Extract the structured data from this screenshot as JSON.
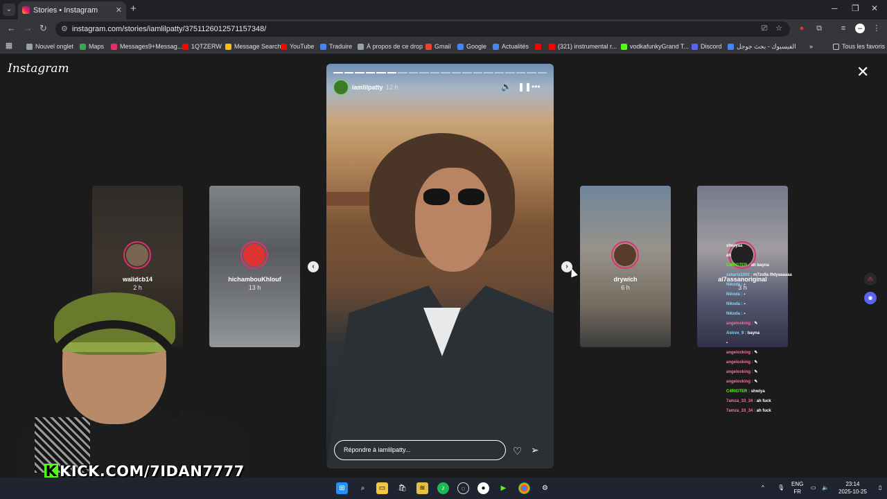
{
  "browser": {
    "tab_title": "Stories • Instagram",
    "url": "instagram.com/stories/iamlilpatty/3751126012571157348/",
    "bookmarks": [
      {
        "label": "Nouvel onglet",
        "color": "#9aa0a6"
      },
      {
        "label": "Maps",
        "color": "#34a853"
      },
      {
        "label": "Messages9+Messag...",
        "color": "#e1306c"
      },
      {
        "label": "1QTZERW",
        "color": "#ff0000"
      },
      {
        "label": "Message Search",
        "color": "#fbbc04"
      },
      {
        "label": "YouTube",
        "color": "#ff0000"
      },
      {
        "label": "Traduire",
        "color": "#4285f4"
      },
      {
        "label": "À propos de ce drop",
        "color": "#9aa0a6"
      },
      {
        "label": "Gmail",
        "color": "#ea4335"
      },
      {
        "label": "Google",
        "color": "#4285f4"
      },
      {
        "label": "Actualités",
        "color": "#4285f4"
      },
      {
        "label": "",
        "color": "#ff0000"
      },
      {
        "label": "(321) instrumental r...",
        "color": "#ff0000"
      },
      {
        "label": "vodkafunkyGrand T...",
        "color": "#53fc18"
      },
      {
        "label": "Discord",
        "color": "#5865f2"
      },
      {
        "label": "الفيسبوك - بحث جوجل",
        "color": "#4285f4"
      }
    ],
    "all_favorites": "Tous les favoris"
  },
  "instagram": {
    "logo": "Instagram",
    "left_stories": [
      {
        "username": "walidcb14",
        "time": "2 h"
      },
      {
        "username": "hichambouKhlouf",
        "time": "13 h"
      }
    ],
    "right_stories": [
      {
        "username": "drywich",
        "time": "6 h"
      },
      {
        "username": "al7assanoriginal",
        "time": "3 h"
      }
    ],
    "current_story": {
      "username": "iamlilpatty",
      "time": "12 h",
      "reply_placeholder": "Répondre à iamlilpatty...",
      "progress_total": 20,
      "progress_done": 6
    }
  },
  "stream": {
    "kick_url": "KICK.COM/7IDAN7777",
    "chat": [
      {
        "user": "",
        "msg": "shwiyaa"
      },
      {
        "user": "",
        "msg": "ah"
      },
      {
        "user": "C4RIGTER :",
        "msg": "ah bayna"
      },
      {
        "user": "zakaria1000 :",
        "msg": "m7zo9a l9dyaaaaaa"
      },
      {
        "user": "Nikoda :",
        "msg": "▪"
      },
      {
        "user": "Nikoda :",
        "msg": "▪"
      },
      {
        "user": "Nikoda :",
        "msg": "▪"
      },
      {
        "user": "Nikoda :",
        "msg": "▪"
      },
      {
        "user": "angeloxking :",
        "msg": "✎"
      },
      {
        "user": "Astrex_9 :",
        "msg": "bayna"
      },
      {
        "user": "",
        "msg": "▪"
      },
      {
        "user": "angeloxking :",
        "msg": "✎"
      },
      {
        "user": "angeloxking :",
        "msg": "✎"
      },
      {
        "user": "angeloxking :",
        "msg": "✎"
      },
      {
        "user": "angeloxking :",
        "msg": "✎"
      },
      {
        "user": "C4RIGTER :",
        "msg": "shwiya"
      },
      {
        "user": "7amza_33_34 :",
        "msg": "ah fuck"
      },
      {
        "user": "7amza_33_34 :",
        "msg": "ah fuck"
      }
    ]
  },
  "taskbar": {
    "lang_line1": "ENG",
    "lang_line2": "FR",
    "time": "23:14",
    "date": "2025-10-25"
  }
}
